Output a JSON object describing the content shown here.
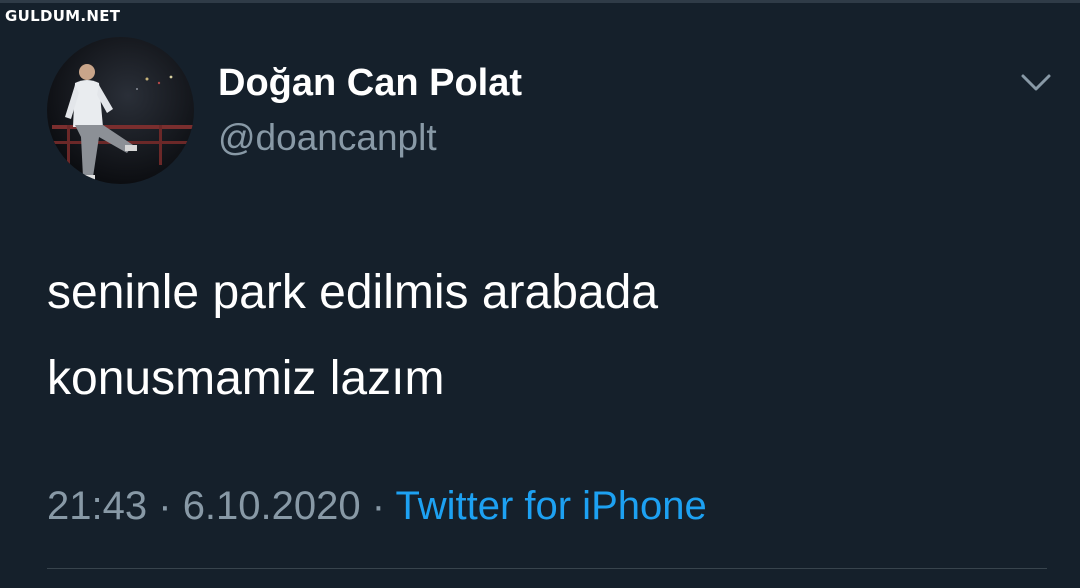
{
  "watermark": "GULDUM.NET",
  "tweet": {
    "author": {
      "display_name": "Doğan Can Polat",
      "handle": "@doancanplt"
    },
    "text_lines": [
      "seninle park edilmis arabada",
      "konusmamiz lazım"
    ],
    "time": "21:43",
    "separator": "·",
    "date": "6.10.2020",
    "source": "Twitter for iPhone"
  },
  "colors": {
    "background": "#15202b",
    "primary_text": "#ffffff",
    "secondary_text": "#8899a6",
    "link": "#1da1f2"
  },
  "icons": {
    "menu": "chevron-down-icon"
  }
}
